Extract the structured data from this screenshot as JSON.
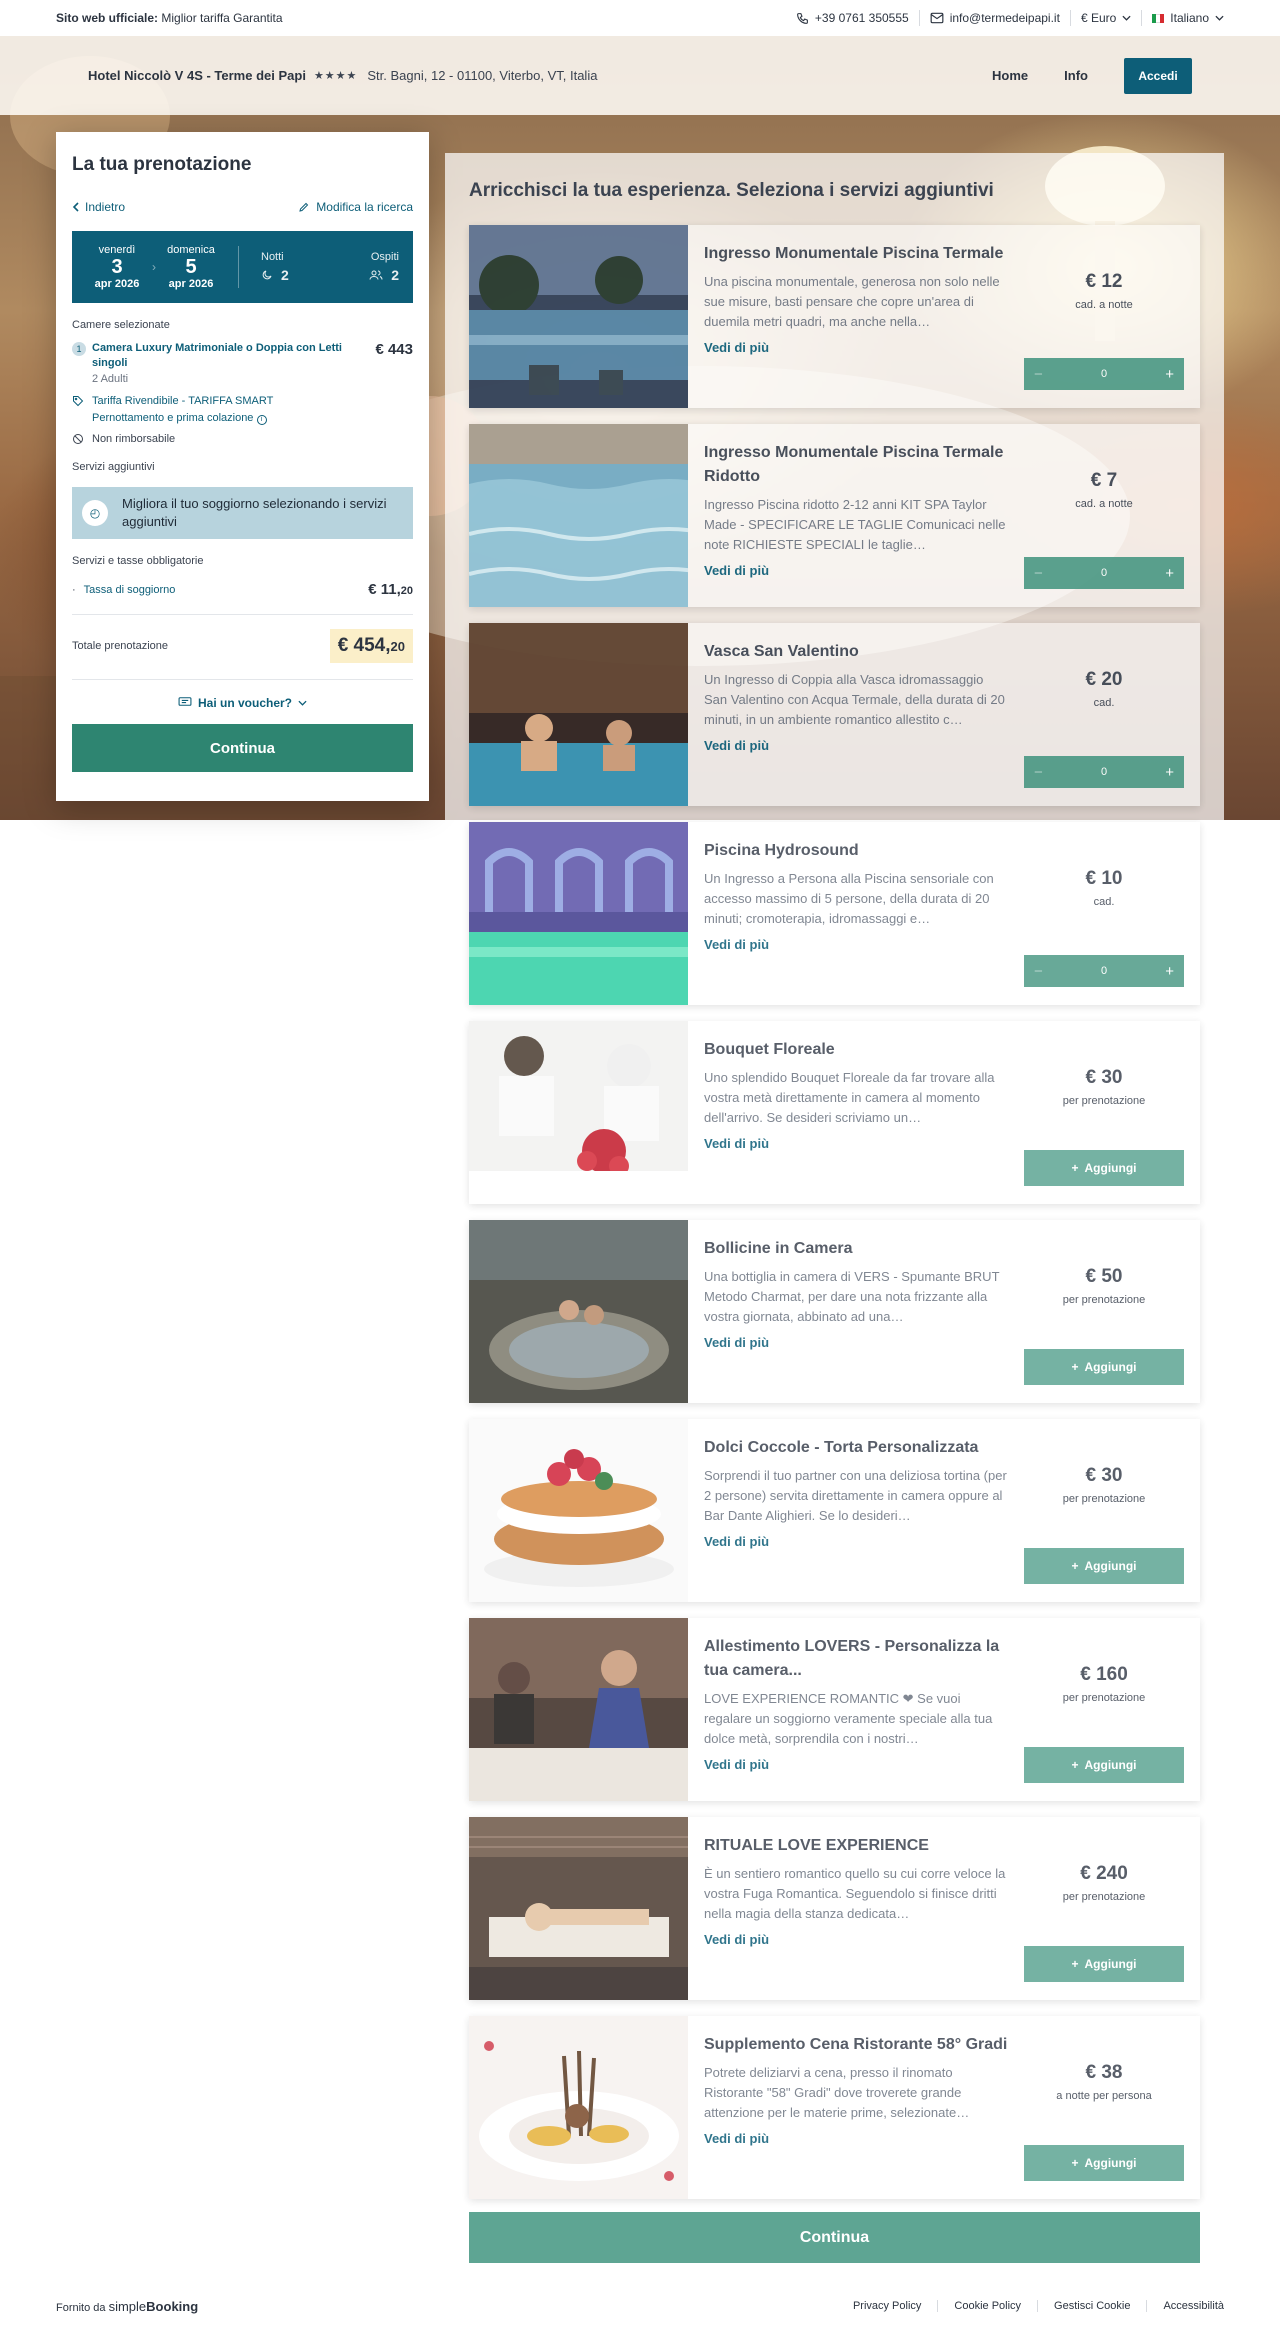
{
  "topbar": {
    "label_bold": "Sito web ufficiale:",
    "label": "Miglior tariffa Garantita",
    "phone": "+39 0761 350555",
    "email": "info@termedeipapi.it",
    "currency": "€ Euro",
    "language": "Italiano"
  },
  "header": {
    "hotel_name": "Hotel Niccolò V 4S - Terme dei Papi",
    "stars": "★★★★",
    "address": "Str. Bagni, 12 - 01100, Viterbo, VT, Italia",
    "nav_home": "Home",
    "nav_info": "Info",
    "login": "Accedi"
  },
  "sidebar": {
    "title": "La tua prenotazione",
    "back": "Indietro",
    "edit": "Modifica la ricerca",
    "checkin": {
      "weekday": "venerdì",
      "day": "3",
      "month": "apr 2026"
    },
    "checkout": {
      "weekday": "domenica",
      "day": "5",
      "month": "apr 2026"
    },
    "nights_label": "Notti",
    "nights": "2",
    "guests_label": "Ospiti",
    "guests": "2",
    "rooms_label": "Camere selezionate",
    "room": {
      "num": "1",
      "title": "Camera Luxury Matrimoniale o Doppia con Letti singoli",
      "guests": "2 Adulti",
      "price": "€ 443",
      "rate": "Tariffa Rivendibile - TARIFFA SMART",
      "board": "Pernottamento e prima colazione",
      "policy": "Non rimborsabile"
    },
    "extras_label": "Servizi aggiuntivi",
    "upsell": "Migliora il tuo soggiorno selezionando i servizi aggiuntivi",
    "taxes_label": "Servizi e tasse obbligatorie",
    "tax": {
      "name": "Tassa di soggiorno",
      "price_int": "€ 11,",
      "price_dec": "20"
    },
    "total_label": "Totale prenotazione",
    "total_int": "€ 454,",
    "total_dec": "20",
    "voucher": "Hai un voucher?",
    "continue": "Continua"
  },
  "main": {
    "title": "Arricchisci la tua esperienza. Seleziona i servizi aggiuntivi",
    "more": "Vedi di più",
    "add": "Aggiungi",
    "continue": "Continua",
    "services": [
      {
        "title": "Ingresso Monumentale Piscina Termale",
        "desc": "Una piscina monumentale, generosa non solo nelle sue misure, basti pensare che copre un'area di duemila metri quadri, ma anche nella…",
        "price": "€ 12",
        "unit": "cad. a notte",
        "qty": "0",
        "image": "pool-night"
      },
      {
        "title": "Ingresso Monumentale Piscina Termale Ridotto",
        "desc": "Ingresso Piscina ridotto 2-12 anni KIT SPA Taylor Made - SPECIFICARE LE TAGLIE Comunicaci nelle note RICHIESTE SPECIALI le taglie…",
        "price": "€ 7",
        "unit": "cad. a notte",
        "qty": "0",
        "image": "pool-water"
      },
      {
        "title": "Vasca San Valentino",
        "desc": "Un Ingresso di Coppia alla Vasca idromassaggio San Valentino con Acqua Termale, della durata di 20 minuti, in un ambiente romantico allestito c…",
        "price": "€ 20",
        "unit": "cad.",
        "qty": "0",
        "image": "couple-tub"
      },
      {
        "title": "Piscina Hydrosound",
        "desc": "Un Ingresso a Persona alla Piscina sensoriale con accesso massimo di 5 persone, della durata di 20 minuti; cromoterapia, idromassaggi e…",
        "price": "€ 10",
        "unit": "cad.",
        "qty": "0",
        "image": "hydro-pool"
      },
      {
        "title": "Bouquet Floreale",
        "desc": "Uno splendido Bouquet Floreale da far trovare alla vostra metà direttamente in camera al momento dell'arrivo. Se desideri scriviamo un…",
        "price": "€ 30",
        "unit": "per prenotazione",
        "image": "bouquet"
      },
      {
        "title": "Bollicine in Camera",
        "desc": "Una bottiglia in camera di VERS - Spumante BRUT Metodo Charmat, per dare una nota frizzante alla vostra giornata, abbinato ad una…",
        "price": "€ 50",
        "unit": "per prenotazione",
        "image": "jacuzzi-night"
      },
      {
        "title": "Dolci Coccole - Torta Personalizzata",
        "desc": "Sorprendi il tuo partner con una deliziosa tortina (per 2 persone) servita direttamente in camera oppure al Bar Dante Alighieri. Se lo desideri…",
        "price": "€ 30",
        "unit": "per prenotazione",
        "image": "cake"
      },
      {
        "title": "Allestimento LOVERS - Personalizza la tua camera...",
        "desc": "LOVE EXPERIENCE ROMANTIC ❤ Se vuoi regalare un soggiorno veramente speciale alla tua dolce metà, sorprendila con i nostri…",
        "price": "€ 160",
        "unit": "per prenotazione",
        "image": "dinner-couple"
      },
      {
        "title": "RITUALE LOVE EXPERIENCE",
        "desc": "È un sentiero romantico quello su cui corre veloce la vostra Fuga Romantica. Seguendolo si finisce dritti nella magia della stanza dedicata…",
        "price": "€ 240",
        "unit": "per prenotazione",
        "image": "massage"
      },
      {
        "title": "Supplemento Cena Ristorante 58° Gradi",
        "desc": "Potrete deliziarvi a cena, presso il rinomato Ristorante \"58\" Gradi\" dove troverete grande attenzione per le materie prime, selezionate…",
        "price": "€ 38",
        "unit": "a notte per persona",
        "image": "dish"
      }
    ]
  },
  "footer": {
    "powered": "Fornito da",
    "brand_a": "simple",
    "brand_b": "Booking",
    "links": [
      "Privacy Policy",
      "Cookie Policy",
      "Gestisci Cookie",
      "Accessibilità"
    ]
  }
}
